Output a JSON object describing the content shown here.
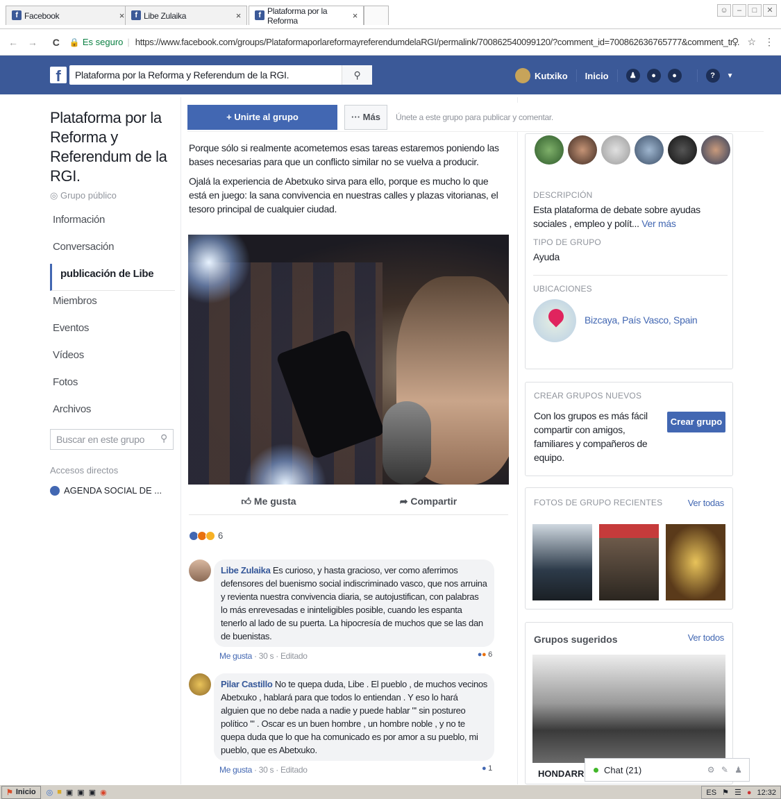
{
  "browser": {
    "tabs": [
      {
        "label": "Facebook",
        "close": "×"
      },
      {
        "label": "Libe Zulaika",
        "close": "×"
      },
      {
        "label": "Plataforma por la Reforma",
        "close": "×"
      }
    ],
    "secure_label": "Es seguro",
    "url": "https://www.facebook.com/groups/PlataformaporlareformayreferendumdelaRGI/permalink/700862540099120/?comment_id=700862636765777&comment_tr..."
  },
  "fb_header": {
    "search_text": "Plataforma por la Reforma y Referendum de la RGI.",
    "user_name": "Kutxiko",
    "home_label": "Inicio"
  },
  "group": {
    "title": "Plataforma por la Reforma y Referendum de la RGI.",
    "type": "Grupo público",
    "nav": [
      "Información",
      "Conversación",
      "publicación de Libe",
      "Miembros",
      "Eventos",
      "Vídeos",
      "Fotos",
      "Archivos"
    ],
    "search_placeholder": "Buscar en este grupo",
    "shortcuts_title": "Accesos directos",
    "shortcut_item": "AGENDA SOCIAL DE ..."
  },
  "joinbar": {
    "join_label": "+ Unirte al grupo",
    "more_label": "··· Más",
    "hint": "Únete a este grupo para publicar y comentar."
  },
  "post": {
    "p1": "Porque sólo si realmente acometemos esas tareas estaremos poniendo las bases necesarias para que un conflicto similar no se vuelva a producir.",
    "p2": "Ojalá la experiencia de Abetxuko sirva para ello, porque es mucho lo que está en juego: la sana convivencia en nuestras calles y plazas vitorianas, el tesoro principal de cualquier ciudad.",
    "like_label": "Me gusta",
    "share_label": "Compartir",
    "reaction_count": "6"
  },
  "comments": [
    {
      "author": "Libe Zulaika",
      "text": "Es curioso, y hasta gracioso, ver como aferrimos defensores del buenismo social indiscriminado vasco, que nos arruina y revienta nuestra convivencia diaria, se autojustifican, con palabras lo más enrevesadas e ininteligibles posible, cuando les espanta tenerlo al lado de su puerta. La hipocresía de muchos que se las dan de buenistas.",
      "like": "Me gusta",
      "meta": " · 30 s · Editado",
      "reactions": "6"
    },
    {
      "author": "Pilar Castillo",
      "text": "No te quepa duda, Libe . El pueblo , de muchos vecinos Abetxuko , hablará para que todos lo entiendan . Y eso lo hará alguien que no debe nada a nadie y puede hablar \"' sin postureo político '\" . Oscar es un buen hombre , un hombre noble , y no te quepa duda que lo que ha comunicado es por amor a su pueblo, mi pueblo, que es Abetxuko.",
      "like": "Me gusta",
      "meta": " · 30 s · Editado",
      "reactions": "1"
    }
  ],
  "sidebar": {
    "desc_title": "DESCRIPCIÓN",
    "desc_text": "Esta plataforma de debate sobre ayudas sociales , empleo y polít...",
    "desc_more": "Ver más",
    "type_title": "TIPO DE GRUPO",
    "type_value": "Ayuda",
    "loc_title": "UBICACIONES",
    "loc_value": "Bizcaya, País Vasco, Spain",
    "create_title": "CREAR GRUPOS NUEVOS",
    "create_text": "Con los grupos es más fácil compartir con amigos, familiares y compañeros de equipo.",
    "create_button": "Crear grupo",
    "photos_title": "FOTOS DE GRUPO RECIENTES",
    "photos_link": "Ver todas",
    "suggested_title": "Grupos sugeridos",
    "suggested_link": "Ver todos",
    "suggested_name": "HONDARRI"
  },
  "chat": {
    "label": "Chat (21)"
  },
  "taskbar": {
    "start": "Inicio",
    "lang": "ES",
    "time": "12:32"
  }
}
